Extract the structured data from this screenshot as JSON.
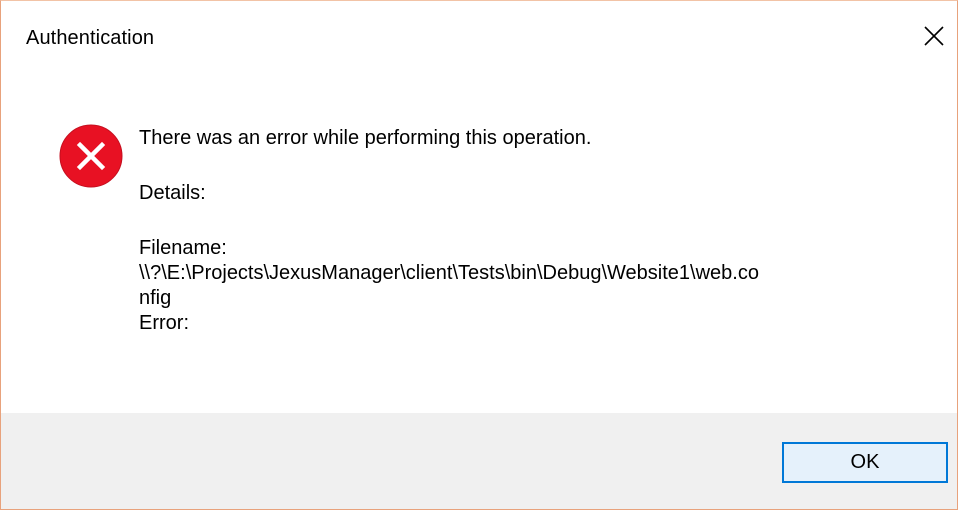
{
  "window": {
    "title": "Authentication"
  },
  "icons": {
    "close": "close-icon",
    "error": "error-icon"
  },
  "message": {
    "headline": "There was an error while performing this operation.",
    "details_label": "Details:",
    "filename_label": "Filename:",
    "filename_line1": "\\\\?\\E:\\Projects\\JexusManager\\client\\Tests\\bin\\Debug\\Website1\\web.co",
    "filename_line2": "nfig",
    "error_label": "Error:"
  },
  "buttons": {
    "ok_label": "OK"
  },
  "colors": {
    "error_red": "#e81123",
    "accent_blue": "#0078d7",
    "footer_gray": "#f0f0f0",
    "window_border": "#e8a27c"
  }
}
